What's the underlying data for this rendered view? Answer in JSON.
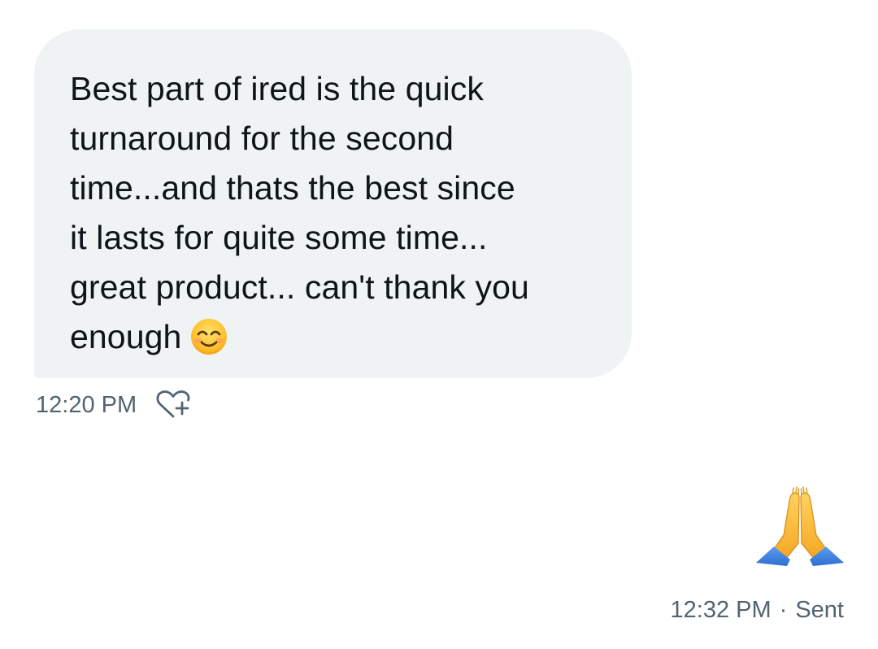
{
  "conversation": {
    "incoming_message": {
      "text": "Best part of ired is the quick\nturnaround for the second\ntime...and thats the best since\nit lasts for quite some time...\ngreat product... can't thank you\nenough",
      "emoji": "smiling-face-with-smiling-eyes",
      "time": "12:20 PM",
      "reaction_icon": "heart-plus-icon"
    },
    "outgoing_message": {
      "emoji": "folded-hands",
      "time": "12:32 PM",
      "separator": "·",
      "status": "Sent"
    }
  },
  "colors": {
    "bubble_background": "#eff3f4",
    "text": "#0f1419",
    "meta_text": "#536471"
  }
}
